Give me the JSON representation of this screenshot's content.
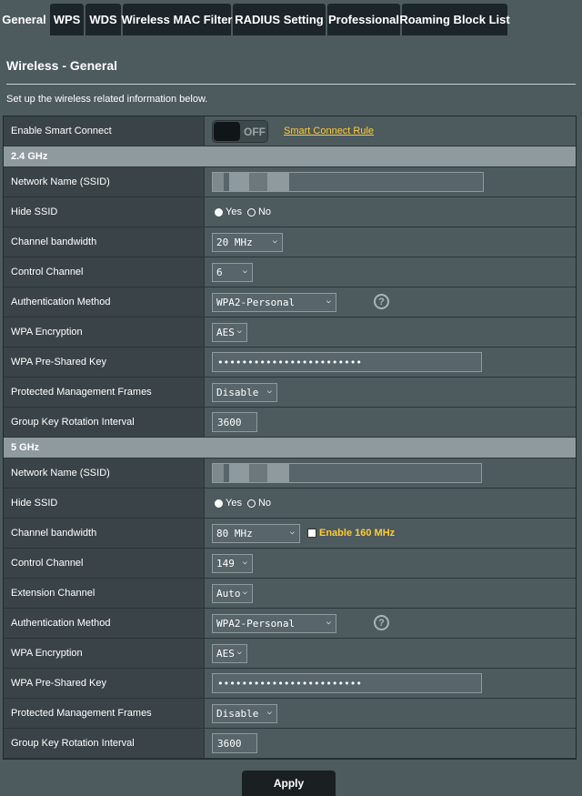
{
  "tabs": [
    "General",
    "WPS",
    "WDS",
    "Wireless MAC Filter",
    "RADIUS Setting",
    "Professional",
    "Roaming Block List"
  ],
  "page": {
    "title": "Wireless - General",
    "description": "Set up the wireless related information below."
  },
  "smart_connect": {
    "label": "Enable Smart Connect",
    "state": "OFF",
    "rule_link": "Smart Connect Rule"
  },
  "band24": {
    "header": "2.4 GHz",
    "ssid_label": "Network Name (SSID)",
    "hide_ssid_label": "Hide SSID",
    "yes": "Yes",
    "no": "No",
    "bandwidth_label": "Channel bandwidth",
    "bandwidth": "20 MHz",
    "control_label": "Control Channel",
    "control": "6",
    "auth_label": "Authentication Method",
    "auth": "WPA2-Personal",
    "encryption_label": "WPA Encryption",
    "encryption": "AES",
    "psk_label": "WPA Pre-Shared Key",
    "psk": "••••••••••••••••••••••••",
    "pmf_label": "Protected Management Frames",
    "pmf": "Disable",
    "gkri_label": "Group Key Rotation Interval",
    "gkri": "3600"
  },
  "band5": {
    "header": "5 GHz",
    "ssid_label": "Network Name (SSID)",
    "hide_ssid_label": "Hide SSID",
    "yes": "Yes",
    "no": "No",
    "bandwidth_label": "Channel bandwidth",
    "bandwidth": "80 MHz",
    "enable160": "Enable 160 MHz",
    "control_label": "Control Channel",
    "control": "149",
    "ext_label": "Extension Channel",
    "ext": "Auto",
    "auth_label": "Authentication Method",
    "auth": "WPA2-Personal",
    "encryption_label": "WPA Encryption",
    "encryption": "AES",
    "psk_label": "WPA Pre-Shared Key",
    "psk": "••••••••••••••••••••••••",
    "pmf_label": "Protected Management Frames",
    "pmf": "Disable",
    "gkri_label": "Group Key Rotation Interval",
    "gkri": "3600"
  },
  "apply_label": "Apply",
  "colors": {
    "accent_link": "#ffcc33",
    "tab_bg": "#1c2529",
    "page_bg": "#4d5a5e"
  },
  "icons": {
    "help": "question-circle-icon",
    "dropdown": "chevron-down-icon"
  }
}
